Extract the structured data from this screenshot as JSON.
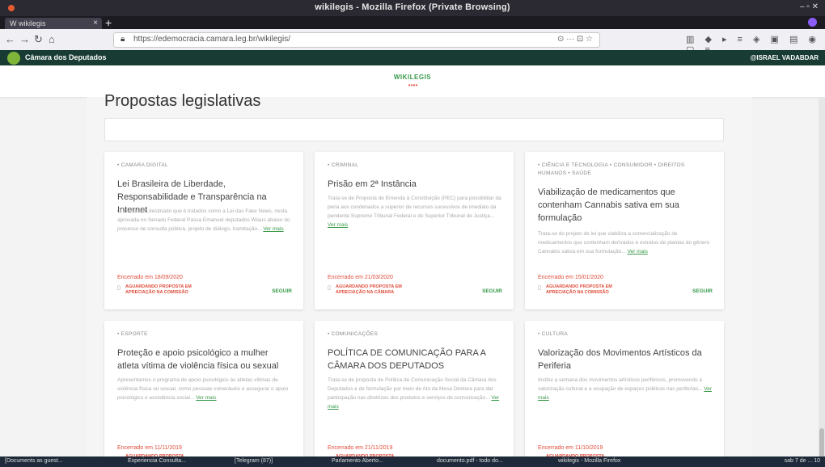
{
  "window": {
    "title": "wikilegis - Mozilla Firefox (Private Browsing)",
    "tab_label": "W wikilegis",
    "url": "https://edemocracia.camara.leg.br/wikilegis/",
    "url_actions": "⊙ ··· ⊡ ☆"
  },
  "camara": {
    "name": "Câmara dos Deputados",
    "right_label": "@ISRAEL VADABDAR"
  },
  "header": {
    "brand": "WIKILEGIS",
    "brand_dots": "• • • •"
  },
  "main": {
    "page_title": "Propostas legislativas",
    "search_placeholder": "",
    "follow_label": "SEGUIR"
  },
  "cards": [
    {
      "tags": "• CAMARA DIGITAL",
      "title": "Lei Brasileira de Liberdade, Responsabilidade e Transparência na Internet",
      "desc": "O ano criado destinado que é tratados como a Lei das Fake News, nesta aprovada no Senado Federal Passa Emanuel deputados Wiaus abaixo do processo de consulta pública, projeto de diálogo, tramitação...",
      "ver_mais": "Ver mais",
      "closed": "Encerrado em 18/09/2020",
      "status": "AGUARDANDO PROPOSTA EM APRECIAÇÃO NA COMISSÃO"
    },
    {
      "tags": "• CRIMINAL",
      "title": "Prisão em 2ª Instância",
      "desc": "Trata-se de Proposta de Emenda à Constituição (PEC) para possibilitar da pena aos condenados a superior de recursos sucessivos de imediato da pendente Supremo Tribunal Federal e do Superior Tribunal de Justiça...",
      "ver_mais": "Ver mais",
      "closed": "Encerrado em 21/03/2020",
      "status": "AGUARDANDO PROPOSTA EM APRECIAÇÃO NA CÂMARA"
    },
    {
      "tags": "• CIÊNCIA E TECNOLOGIA • CONSUMIDOR • DIREITOS HUMANOS • SAÚDE",
      "title": "Viabilização de medicamentos que contenham Cannabis sativa em sua formulação",
      "desc": "Trata-se do projeto de lei que viabiliza a comercialização de medicamentos que contenham derivados e extratos de plantas do gênero Cannabis sativa em sua formulação...",
      "ver_mais": "Ver mais",
      "closed": "Encerrado em 15/01/2020",
      "status": "AGUARDANDO PROPOSTA EM APRECIAÇÃO NA COMISSÃO"
    },
    {
      "tags": "• ESPORTE",
      "title": "Proteção e apoio psicológico a mulher atleta vítima de violência física ou sexual",
      "desc": "Apresentamos o programa de apoio psicológico às atletas vítimas de violência física ou sexual, como pessoas vulneráveis e assegurar o apoio psicológico e assistência social...",
      "ver_mais": "Ver mais",
      "closed": "Encerrado em 11/11/2019",
      "status": "AGUARDANDO PROPOSTA"
    },
    {
      "tags": "• COMUNICAÇÕES",
      "title": "POLÍTICA DE COMUNICAÇÃO PARA A CÂMARA DOS DEPUTADOS",
      "desc": "Trata-se de proposta de Política de Comunicação Social da Câmara dos Deputados e de formulação por meio de Ato da Mesa Diretora para dar participação nas diretrizes dos produtos e serviços de comunicação...",
      "ver_mais": "Ver mais",
      "closed": "Encerrado em 21/11/2019",
      "status": "AGUARDANDO PROPOSTA"
    },
    {
      "tags": "• CULTURA",
      "title": "Valorização dos Movimentos Artísticos da Periferia",
      "desc": "Institui a semana dos movimentos artísticos periféricos, promovendo a valorização cultural e a ocupação de espaços públicos nas periferias...",
      "ver_mais": "Ver mais",
      "closed": "Encerrado em 11/10/2019",
      "status": "AGUARDANDO PROPOSTA"
    }
  ],
  "taskbar": {
    "items": [
      "[Documents as guest...",
      "Experiencia Consulta...",
      "[Telegram (87)]",
      "Parlamento Aberto...",
      "documento.pdf - todo do...",
      "wikilegis - Mozilla Firefox"
    ],
    "clock": "sab 7 de ... 10"
  }
}
